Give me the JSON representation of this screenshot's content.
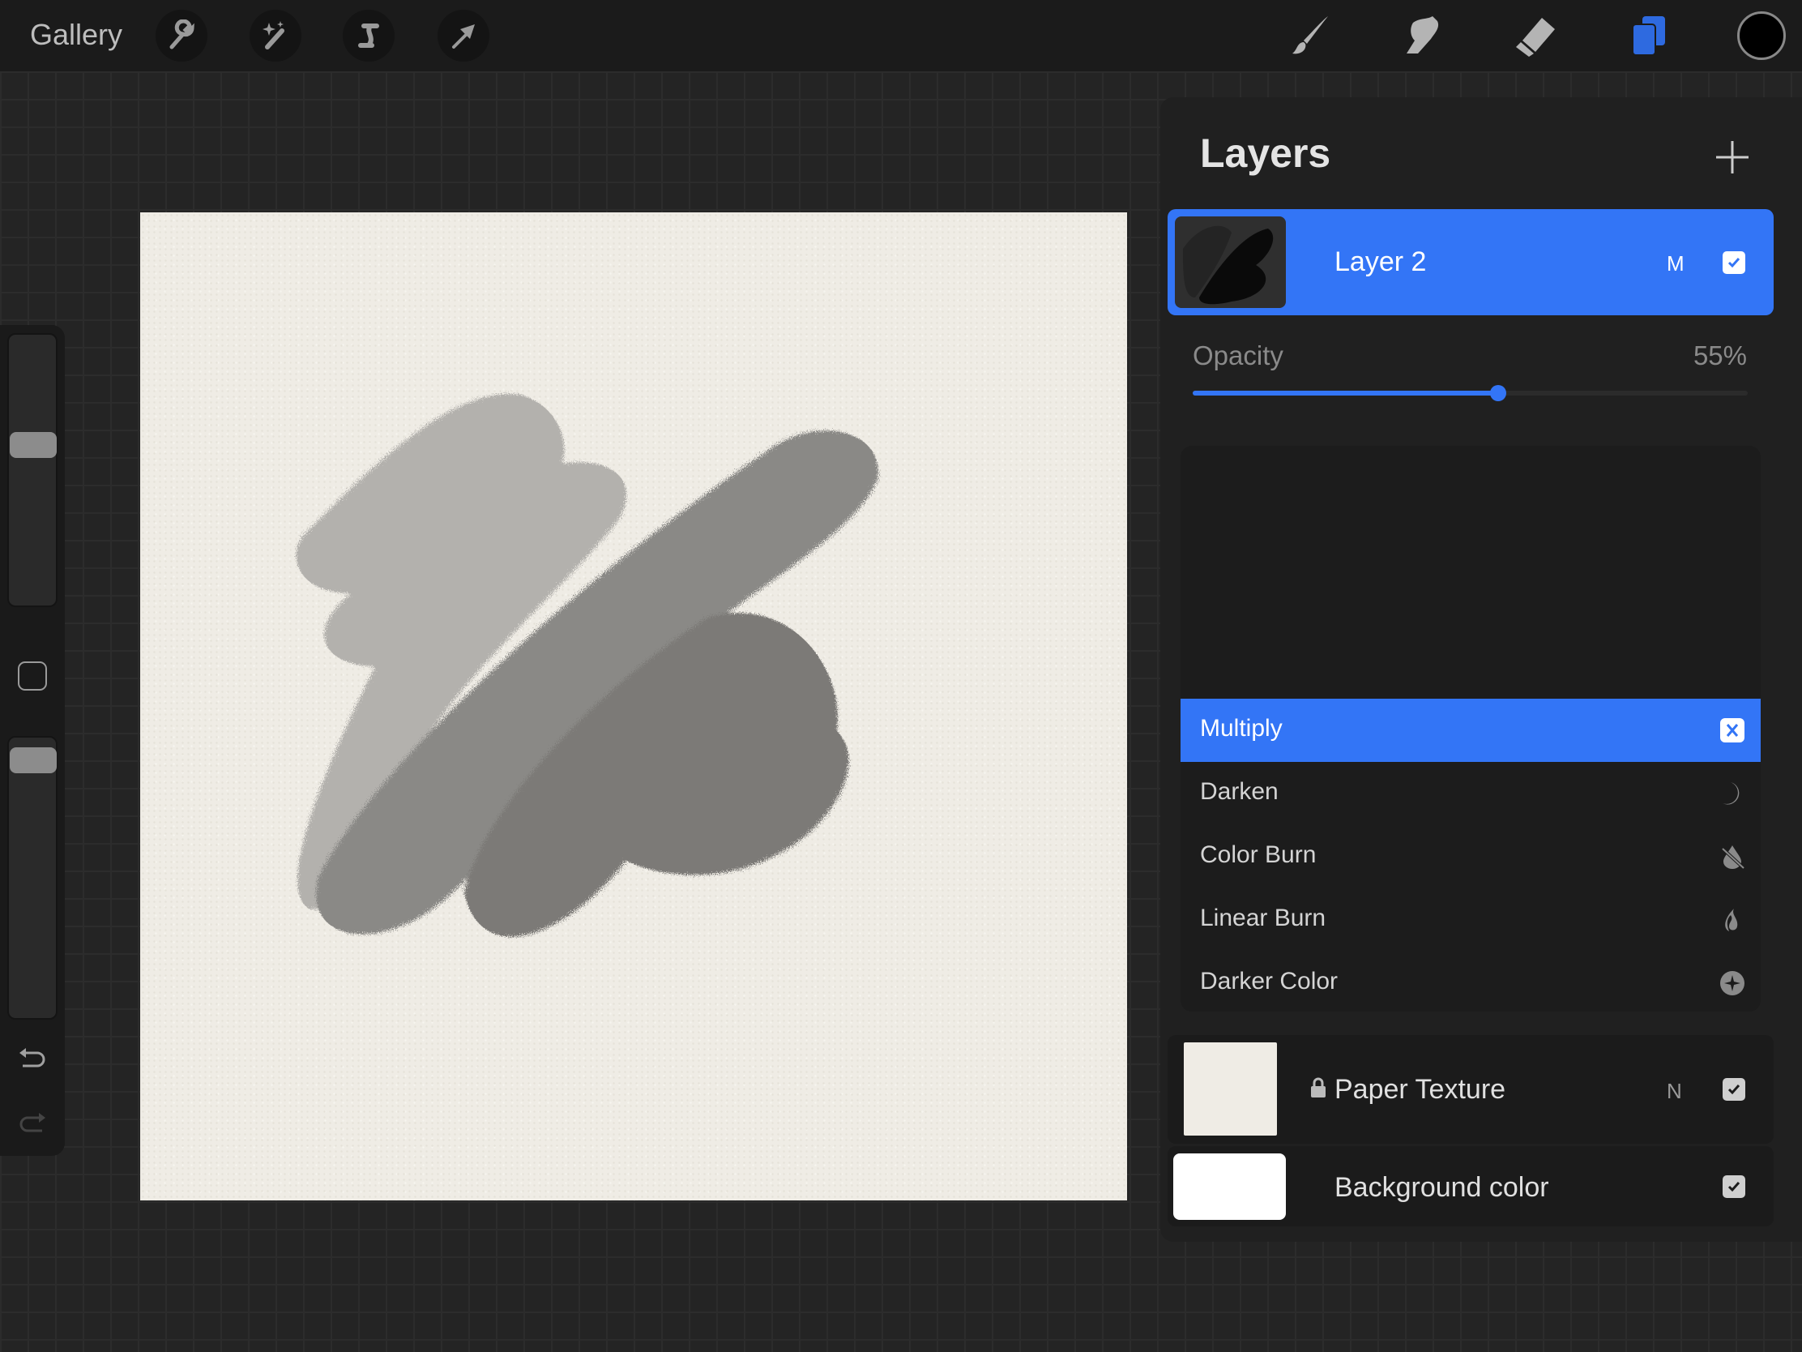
{
  "topbar": {
    "gallery_label": "Gallery",
    "left_tools": [
      "wrench-icon",
      "magic-wand-icon",
      "selection-s-icon",
      "transform-arrow-icon"
    ],
    "right_tools": [
      "brush-icon",
      "smudge-icon",
      "eraser-icon",
      "layers-icon",
      "color-icon"
    ],
    "current_color": "#000000",
    "accent": "#3375f6"
  },
  "layers_panel": {
    "title": "Layers",
    "add_icon": "plus-icon",
    "layers": [
      {
        "name": "Layer 2",
        "blend_code": "M",
        "visible": true,
        "selected": true
      },
      {
        "name": "Paper Texture",
        "blend_code": "N",
        "visible": true,
        "locked": true
      },
      {
        "name": "Background color",
        "visible": true
      }
    ],
    "opacity": {
      "label": "Opacity",
      "value_text": "55%",
      "value": 55
    },
    "blend_modes": [
      {
        "label": "Multiply",
        "icon": "multiply-icon",
        "selected": true
      },
      {
        "label": "Darken",
        "icon": "moon-icon"
      },
      {
        "label": "Color Burn",
        "icon": "burn-drop-icon"
      },
      {
        "label": "Linear Burn",
        "icon": "flame-icon"
      },
      {
        "label": "Darker Color",
        "icon": "sparkle-circle-icon"
      }
    ]
  },
  "sidebar": {
    "brush_size": 0.75,
    "brush_opacity": 1.0
  }
}
